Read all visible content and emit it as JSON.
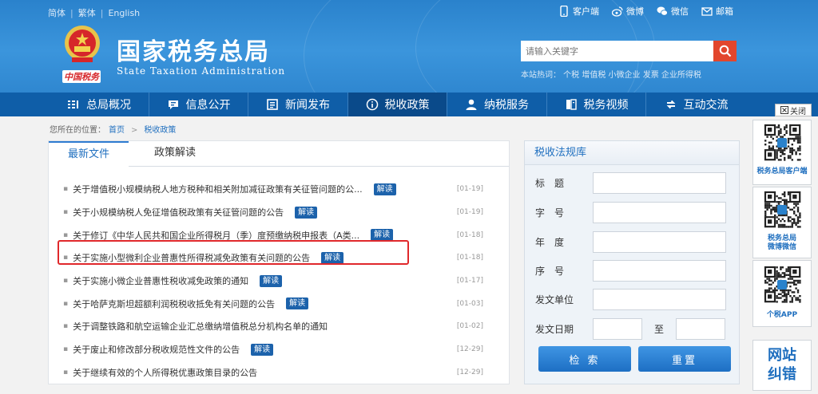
{
  "header": {
    "languages": [
      "简体",
      "繁体",
      "English"
    ],
    "title": "国家税务总局",
    "subtitle": "State Taxation Administration",
    "slogan": "中国税务",
    "top_links": [
      {
        "label": "客户端",
        "icon": "mobile-icon"
      },
      {
        "label": "微博",
        "icon": "weibo-icon"
      },
      {
        "label": "微信",
        "icon": "wechat-icon"
      },
      {
        "label": "邮箱",
        "icon": "mail-icon"
      }
    ],
    "search_placeholder": "请输入关键字",
    "hot_words": "本站热词： 个税 增值税 小微企业 发票 企业所得税"
  },
  "nav": {
    "items": [
      {
        "label": "总局概况",
        "icon": "list-icon"
      },
      {
        "label": "信息公开",
        "icon": "chat-bubble-icon"
      },
      {
        "label": "新闻发布",
        "icon": "news-icon"
      },
      {
        "label": "税收政策",
        "icon": "info-icon"
      },
      {
        "label": "纳税服务",
        "icon": "person-icon"
      },
      {
        "label": "税务视频",
        "icon": "video-icon"
      },
      {
        "label": "互动交流",
        "icon": "exchange-icon"
      }
    ],
    "active_index": 3
  },
  "breadcrumb": {
    "prefix": "您所在的位置：",
    "home": "首页",
    "separator": ">",
    "current": "税收政策"
  },
  "left_panel": {
    "tabs": [
      "最新文件",
      "政策解读"
    ],
    "badge_label": "解读",
    "items": [
      {
        "title": "关于增值税小规模纳税人地方税种和相关附加减征政策有关征管问题的公...",
        "has_badge": true,
        "date": "[01-19]"
      },
      {
        "title": "关于小规模纳税人免征增值税政策有关征管问题的公告",
        "has_badge": true,
        "date": "[01-19]"
      },
      {
        "title": "关于修订《中华人民共和国企业所得税月（季）度预缴纳税申报表（A类...",
        "has_badge": true,
        "date": "[01-18]"
      },
      {
        "title": "关于实施小型微利企业普惠性所得税减免政策有关问题的公告",
        "has_badge": true,
        "date": "[01-18]",
        "highlighted": true
      },
      {
        "title": "关于实施小微企业普惠性税收减免政策的通知",
        "has_badge": true,
        "date": "[01-17]"
      },
      {
        "title": "关于哈萨克斯坦超额利润税税收抵免有关问题的公告",
        "has_badge": true,
        "date": "[01-03]"
      },
      {
        "title": "关于调整铁路和航空运输企业汇总缴纳增值税总分机构名单的通知",
        "has_badge": false,
        "date": "[01-02]"
      },
      {
        "title": "关于废止和修改部分税收规范性文件的公告",
        "has_badge": true,
        "date": "[12-29]"
      },
      {
        "title": "关于继续有效的个人所得税优惠政策目录的公告",
        "has_badge": false,
        "date": "[12-29]"
      }
    ]
  },
  "right_panel": {
    "title": "税收法规库",
    "fields": [
      "标　题",
      "字　号",
      "年　度",
      "序　号",
      "发文单位",
      "发文日期"
    ],
    "date_to": "至",
    "search_button": "检 索",
    "reset_button": "重置"
  },
  "float": {
    "close_label": "关闭",
    "qr_labels": [
      "税务总局客户端",
      "税务总局\n微博微信",
      "个税APP"
    ],
    "error_label_1": "网站",
    "error_label_2": "纠错"
  },
  "colors": {
    "brand_blue": "#2a82cc",
    "nav_blue": "#0f5ea8",
    "nav_active": "#0a4a8a",
    "badge": "#1c62ab",
    "highlight": "#e0282b",
    "search_button": "#e2462d"
  }
}
